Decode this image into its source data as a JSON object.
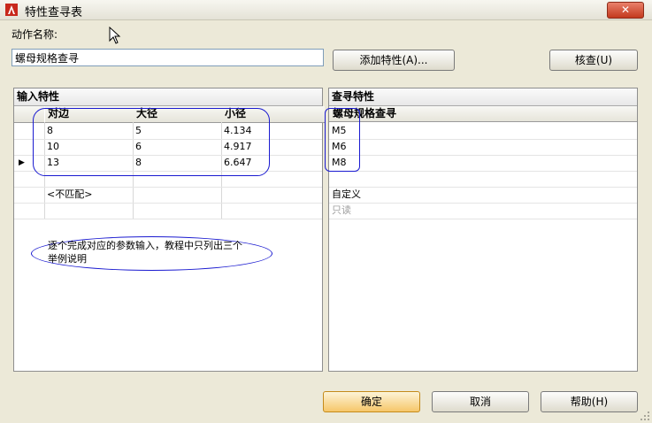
{
  "window": {
    "title": "特性查寻表",
    "close": "✕"
  },
  "action_name": {
    "label": "动作名称:",
    "value": "螺母规格查寻"
  },
  "buttons": {
    "add_property": "添加特性(A)...",
    "check": "核查(U)",
    "ok": "确定",
    "cancel": "取消",
    "help": "帮助(H)"
  },
  "input_panel": {
    "title": "输入特性",
    "columns": [
      "对边",
      "大径",
      "小径"
    ],
    "rows": [
      [
        "8",
        "5",
        "4.134"
      ],
      [
        "10",
        "6",
        "4.917"
      ],
      [
        "13",
        "8",
        "6.647"
      ]
    ],
    "unmatched": "<不匹配>",
    "current_row_marker": "▶"
  },
  "lookup_panel": {
    "title": "查寻特性",
    "column": "螺母规格查寻",
    "values": [
      "M5",
      "M6",
      "M8"
    ],
    "custom": "自定义",
    "readonly": "只读"
  },
  "annotation": {
    "text_line1": "逐个完成对应的参数输入，教程中只列出三个",
    "text_line2": "举例说明"
  }
}
